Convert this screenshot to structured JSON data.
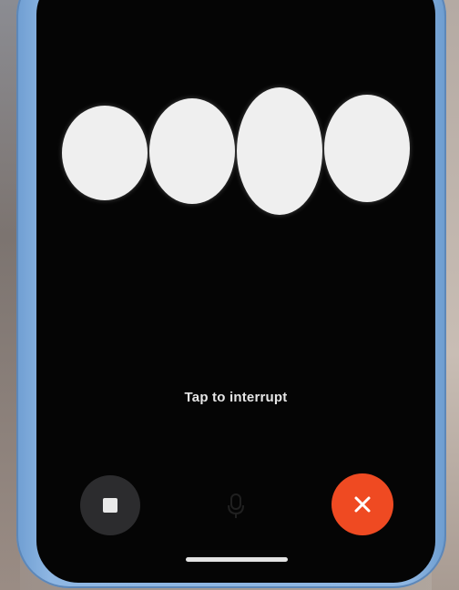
{
  "voice_mode": {
    "status_text": "Tap to interrupt",
    "visualizer_bars": [
      0.74,
      0.83,
      1.0,
      0.84
    ]
  },
  "controls": {
    "stop_icon": "stop-square-icon",
    "mic_icon": "microphone-icon",
    "close_icon": "close-x-icon"
  },
  "colors": {
    "screen_background": "#050505",
    "blob": "#efefef",
    "stop_button": "#2c2c2e",
    "close_button": "#ef4a22",
    "phone_frame": "#8db5e1"
  }
}
